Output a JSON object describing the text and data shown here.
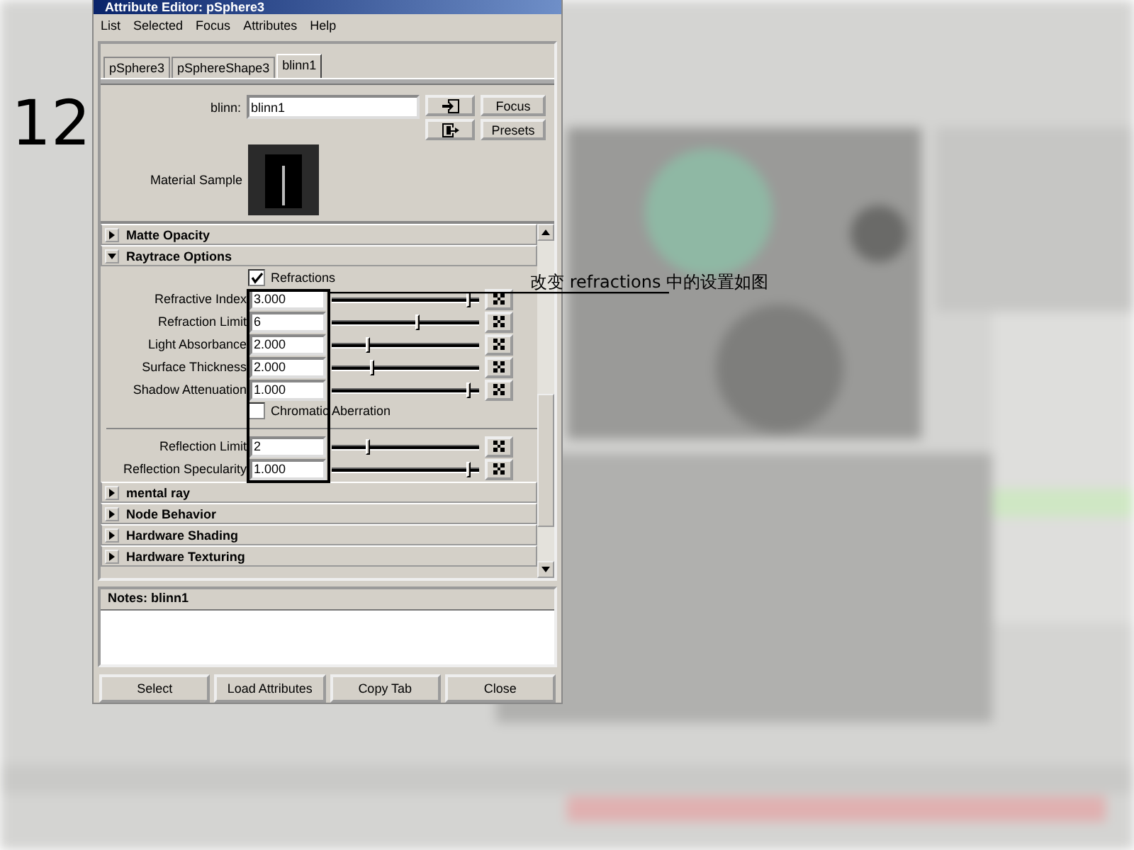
{
  "step_number": "12",
  "window": {
    "title": "Attribute Editor: pSphere3"
  },
  "menu": [
    "List",
    "Selected",
    "Focus",
    "Attributes",
    "Help"
  ],
  "tabs": [
    {
      "label": "pSphere3",
      "selected": false
    },
    {
      "label": "pSphereShape3",
      "selected": false
    },
    {
      "label": "blinn1",
      "selected": true
    }
  ],
  "node": {
    "label": "blinn:",
    "value": "blinn1"
  },
  "side_buttons": [
    "Focus",
    "Presets"
  ],
  "material_sample": {
    "label": "Material Sample"
  },
  "sections": [
    {
      "title": "Matte Opacity",
      "expanded": false
    },
    {
      "title": "Raytrace Options",
      "expanded": true,
      "attributes": [
        {
          "kind": "checkbox",
          "label": "Refractions",
          "checked": true
        },
        {
          "kind": "slider",
          "label": "Refractive Index",
          "value": "3.000",
          "level": 0.97
        },
        {
          "kind": "slider",
          "label": "Refraction Limit",
          "value": "6",
          "level": 0.6
        },
        {
          "kind": "slider",
          "label": "Light Absorbance",
          "value": "2.000",
          "level": 0.24
        },
        {
          "kind": "slider",
          "label": "Surface Thickness",
          "value": "2.000",
          "level": 0.28
        },
        {
          "kind": "slider",
          "label": "Shadow Attenuation",
          "value": "1.000",
          "level": 0.97
        },
        {
          "kind": "checkbox",
          "label": "Chromatic Aberration",
          "checked": false
        },
        {
          "kind": "separator"
        },
        {
          "kind": "slider",
          "label": "Reflection Limit",
          "value": "2",
          "level": 0.24
        },
        {
          "kind": "slider",
          "label": "Reflection Specularity",
          "value": "1.000",
          "level": 0.97
        }
      ]
    },
    {
      "title": "mental ray",
      "expanded": false
    },
    {
      "title": "Node Behavior",
      "expanded": false
    },
    {
      "title": "Hardware Shading",
      "expanded": false
    },
    {
      "title": "Hardware Texturing",
      "expanded": false
    }
  ],
  "notes": {
    "title": "Notes: blinn1"
  },
  "buttons": [
    "Select",
    "Load Attributes",
    "Copy Tab",
    "Close"
  ],
  "annotation": {
    "text": "改变 refractions 中的设置如图"
  }
}
